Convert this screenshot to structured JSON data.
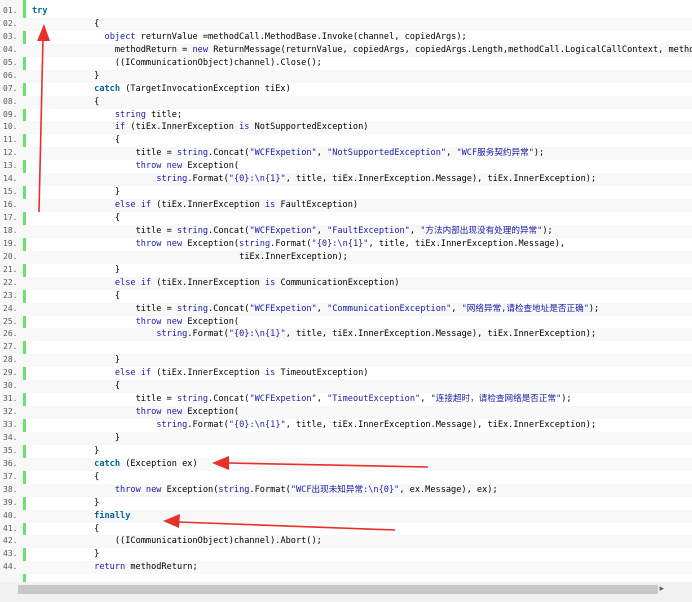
{
  "code_view": {
    "lines": [
      {
        "n": "01.",
        "indent": 0,
        "parts": [
          [
            "kw",
            "try"
          ]
        ]
      },
      {
        "n": "02.",
        "indent": 12,
        "parts": [
          [
            "plain",
            "{"
          ]
        ]
      },
      {
        "n": "03.",
        "indent": 14,
        "parts": [
          [
            "kw2",
            "object "
          ],
          [
            "plain",
            "returnValue =methodCall.MethodBase.Invoke(channel, copiedArgs);"
          ]
        ]
      },
      {
        "n": "04.",
        "indent": 16,
        "parts": [
          [
            "plain",
            "methodReturn = "
          ],
          [
            "kw2",
            "new "
          ],
          [
            "plain",
            "ReturnMessage(returnValue, copiedArgs, copiedArgs.Length,methodCall.LogicalCallContext, methodCall"
          ]
        ]
      },
      {
        "n": "05.",
        "indent": 16,
        "parts": [
          [
            "plain",
            "((ICommunicationObject)channel).Close();"
          ]
        ]
      },
      {
        "n": "06.",
        "indent": 12,
        "parts": [
          [
            "plain",
            "}"
          ]
        ]
      },
      {
        "n": "07.",
        "indent": 12,
        "parts": [
          [
            "kw",
            "catch "
          ],
          [
            "plain",
            "(TargetInvocationException tiEx)"
          ]
        ]
      },
      {
        "n": "08.",
        "indent": 12,
        "parts": [
          [
            "plain",
            "{"
          ]
        ]
      },
      {
        "n": "09.",
        "indent": 16,
        "parts": [
          [
            "kw2",
            "string "
          ],
          [
            "plain",
            "title;"
          ]
        ]
      },
      {
        "n": "10.",
        "indent": 16,
        "parts": [
          [
            "kw2",
            "if "
          ],
          [
            "plain",
            "(tiEx.InnerException "
          ],
          [
            "kw2",
            "is "
          ],
          [
            "plain",
            "NotSupportedException)"
          ]
        ]
      },
      {
        "n": "11.",
        "indent": 16,
        "parts": [
          [
            "plain",
            "{"
          ]
        ]
      },
      {
        "n": "12.",
        "indent": 20,
        "parts": [
          [
            "plain",
            "title = "
          ],
          [
            "kw2",
            "string"
          ],
          [
            "plain",
            ".Concat("
          ],
          [
            "str",
            "\"WCFExpetion\""
          ],
          [
            "plain",
            ", "
          ],
          [
            "str",
            "\"NotSupportedException\""
          ],
          [
            "plain",
            ", "
          ],
          [
            "str",
            "\"WCF服务契约异常\""
          ],
          [
            "plain",
            ");"
          ]
        ]
      },
      {
        "n": "13.",
        "indent": 20,
        "parts": [
          [
            "kw2",
            "throw new "
          ],
          [
            "plain",
            "Exception("
          ]
        ]
      },
      {
        "n": "14.",
        "indent": 24,
        "parts": [
          [
            "kw2",
            "string"
          ],
          [
            "plain",
            ".Format("
          ],
          [
            "str",
            "\"{0}:\\n{1}\""
          ],
          [
            "plain",
            ", title, tiEx.InnerException.Message), tiEx.InnerException);"
          ]
        ]
      },
      {
        "n": "15.",
        "indent": 16,
        "parts": [
          [
            "plain",
            "}"
          ]
        ]
      },
      {
        "n": "16.",
        "indent": 16,
        "parts": [
          [
            "kw2",
            "else if "
          ],
          [
            "plain",
            "(tiEx.InnerException "
          ],
          [
            "kw2",
            "is "
          ],
          [
            "plain",
            "FaultException)"
          ]
        ]
      },
      {
        "n": "17.",
        "indent": 16,
        "parts": [
          [
            "plain",
            "{"
          ]
        ]
      },
      {
        "n": "18.",
        "indent": 20,
        "parts": [
          [
            "plain",
            "title = "
          ],
          [
            "kw2",
            "string"
          ],
          [
            "plain",
            ".Concat("
          ],
          [
            "str",
            "\"WCFExpetion\""
          ],
          [
            "plain",
            ", "
          ],
          [
            "str",
            "\"FaultException\""
          ],
          [
            "plain",
            ", "
          ],
          [
            "str",
            "\"方法内部出现没有处理的异常\""
          ],
          [
            "plain",
            ");"
          ]
        ]
      },
      {
        "n": "19.",
        "indent": 20,
        "parts": [
          [
            "kw2",
            "throw new "
          ],
          [
            "plain",
            "Exception("
          ],
          [
            "kw2",
            "string"
          ],
          [
            "plain",
            ".Format("
          ],
          [
            "str",
            "\"{0}:\\n{1}\""
          ],
          [
            "plain",
            ", title, tiEx.InnerException.Message),"
          ]
        ]
      },
      {
        "n": "20.",
        "indent": 40,
        "parts": [
          [
            "plain",
            "tiEx.InnerException);"
          ]
        ]
      },
      {
        "n": "21.",
        "indent": 16,
        "parts": [
          [
            "plain",
            "}"
          ]
        ]
      },
      {
        "n": "22.",
        "indent": 16,
        "parts": [
          [
            "kw2",
            "else if "
          ],
          [
            "plain",
            "(tiEx.InnerException "
          ],
          [
            "kw2",
            "is "
          ],
          [
            "plain",
            "CommunicationException)"
          ]
        ]
      },
      {
        "n": "23.",
        "indent": 16,
        "parts": [
          [
            "plain",
            "{"
          ]
        ]
      },
      {
        "n": "24.",
        "indent": 20,
        "parts": [
          [
            "plain",
            "title = "
          ],
          [
            "kw2",
            "string"
          ],
          [
            "plain",
            ".Concat("
          ],
          [
            "str",
            "\"WCFExpetion\""
          ],
          [
            "plain",
            ", "
          ],
          [
            "str",
            "\"CommunicationException\""
          ],
          [
            "plain",
            ", "
          ],
          [
            "str",
            "\"网络异常,请检查地址是否正确\""
          ],
          [
            "plain",
            ");"
          ]
        ]
      },
      {
        "n": "25.",
        "indent": 20,
        "parts": [
          [
            "kw2",
            "throw new "
          ],
          [
            "plain",
            "Exception("
          ]
        ]
      },
      {
        "n": "26.",
        "indent": 24,
        "parts": [
          [
            "kw2",
            "string"
          ],
          [
            "plain",
            ".Format("
          ],
          [
            "str",
            "\"{0}:\\n{1}\""
          ],
          [
            "plain",
            ", title, tiEx.InnerException.Message), tiEx.InnerException);"
          ]
        ]
      },
      {
        "n": "27.",
        "indent": 0,
        "parts": []
      },
      {
        "n": "28.",
        "indent": 16,
        "parts": [
          [
            "plain",
            "}"
          ]
        ]
      },
      {
        "n": "29.",
        "indent": 16,
        "parts": [
          [
            "kw2",
            "else if "
          ],
          [
            "plain",
            "(tiEx.InnerException "
          ],
          [
            "kw2",
            "is "
          ],
          [
            "plain",
            "TimeoutException)"
          ]
        ]
      },
      {
        "n": "30.",
        "indent": 16,
        "parts": [
          [
            "plain",
            "{"
          ]
        ]
      },
      {
        "n": "31.",
        "indent": 20,
        "parts": [
          [
            "plain",
            "title = "
          ],
          [
            "kw2",
            "string"
          ],
          [
            "plain",
            ".Concat("
          ],
          [
            "str",
            "\"WCFExpetion\""
          ],
          [
            "plain",
            ", "
          ],
          [
            "str",
            "\"TimeoutException\""
          ],
          [
            "plain",
            ", "
          ],
          [
            "str",
            "\"连接超时，请检查网络是否正常\""
          ],
          [
            "plain",
            ");"
          ]
        ]
      },
      {
        "n": "32.",
        "indent": 20,
        "parts": [
          [
            "kw2",
            "throw new "
          ],
          [
            "plain",
            "Exception("
          ]
        ]
      },
      {
        "n": "33.",
        "indent": 24,
        "parts": [
          [
            "kw2",
            "string"
          ],
          [
            "plain",
            ".Format("
          ],
          [
            "str",
            "\"{0}:\\n{1}\""
          ],
          [
            "plain",
            ", title, tiEx.InnerException.Message), tiEx.InnerException);"
          ]
        ]
      },
      {
        "n": "34.",
        "indent": 16,
        "parts": [
          [
            "plain",
            "}"
          ]
        ]
      },
      {
        "n": "35.",
        "indent": 12,
        "parts": [
          [
            "plain",
            "}"
          ]
        ]
      },
      {
        "n": "36.",
        "indent": 12,
        "parts": [
          [
            "kw",
            "catch "
          ],
          [
            "plain",
            "(Exception ex)"
          ]
        ]
      },
      {
        "n": "37.",
        "indent": 12,
        "parts": [
          [
            "plain",
            "{"
          ]
        ]
      },
      {
        "n": "38.",
        "indent": 16,
        "parts": [
          [
            "kw2",
            "throw new "
          ],
          [
            "plain",
            "Exception("
          ],
          [
            "kw2",
            "string"
          ],
          [
            "plain",
            ".Format("
          ],
          [
            "str",
            "\"WCF出现未知异常:\\n{0}\""
          ],
          [
            "plain",
            ", ex.Message), ex);"
          ]
        ]
      },
      {
        "n": "39.",
        "indent": 12,
        "parts": [
          [
            "plain",
            "}"
          ]
        ]
      },
      {
        "n": "40.",
        "indent": 12,
        "parts": [
          [
            "kw",
            "finally"
          ]
        ]
      },
      {
        "n": "41.",
        "indent": 12,
        "parts": [
          [
            "plain",
            "{"
          ]
        ]
      },
      {
        "n": "42.",
        "indent": 16,
        "parts": [
          [
            "plain",
            "((ICommunicationObject)channel).Abort();"
          ]
        ]
      },
      {
        "n": "43.",
        "indent": 12,
        "parts": [
          [
            "plain",
            "}"
          ]
        ]
      },
      {
        "n": "44.",
        "indent": 12,
        "parts": [
          [
            "kw2",
            "return "
          ],
          [
            "plain",
            "methodReturn;"
          ]
        ]
      }
    ]
  },
  "scrollbar": {
    "right_arrow": "▸"
  },
  "colors": {
    "keyword": "#006699",
    "string": "#1a1aa6",
    "gutter_bar": "#6ce26c",
    "arrow": "#e8302a"
  }
}
